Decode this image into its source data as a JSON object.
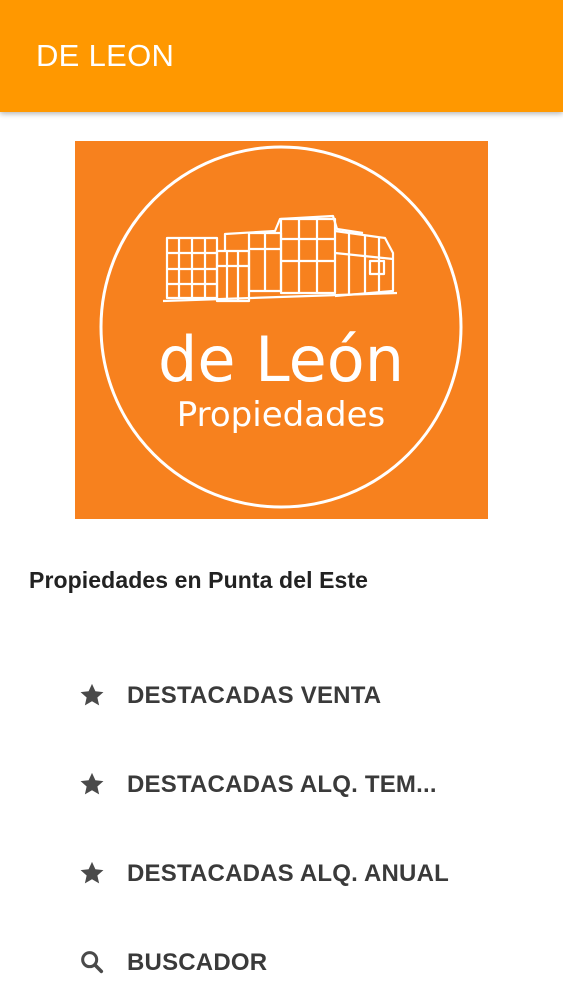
{
  "app_bar": {
    "title": "DE LEON",
    "color": "#FF9800"
  },
  "logo": {
    "line1": "de León",
    "line2": "Propiedades",
    "background": "#F7811E"
  },
  "subtitle": "Propiedades en Punta del Este",
  "menu": {
    "items": [
      {
        "label": "DESTACADAS VENTA",
        "icon": "star-icon"
      },
      {
        "label": "DESTACADAS ALQ. TEM...",
        "icon": "star-icon"
      },
      {
        "label": "DESTACADAS ALQ. ANUAL",
        "icon": "star-icon"
      },
      {
        "label": "BUSCADOR",
        "icon": "search-icon"
      }
    ]
  }
}
